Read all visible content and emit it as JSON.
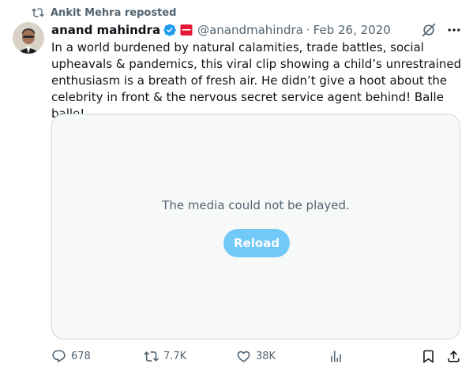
{
  "repost": {
    "text": "Ankit Mehra reposted",
    "icon": "repost-icon"
  },
  "author": {
    "name": "anand mahindra",
    "handle": "@anandmahindra",
    "separator": "·",
    "date": "Feb 26, 2020",
    "verified_icon": "verified-badge-icon",
    "affiliate_icon": "affiliate-badge-icon",
    "verified_color": "#1d9bf0",
    "affiliate_color": "#e31837"
  },
  "header_actions": {
    "grok_icon": "grok-icon",
    "more_icon": "more-icon"
  },
  "tweet": {
    "text": "In a world burdened by natural calamities, trade battles, social upheavals & pandemics, this viral clip showing a child’s unrestrained enthusiasm is a breath of fresh air. He didn’t give a hoot about the celebrity in front & the nervous secret service agent behind! Balle balle!"
  },
  "media": {
    "message": "The media could not be played.",
    "reload_label": "Reload",
    "reload_color": "#71c9f8"
  },
  "actions": {
    "reply_count": "678",
    "retweet_count": "7.7K",
    "like_count": "38K",
    "views_icon": "views-icon",
    "bookmark_icon": "bookmark-icon",
    "share_icon": "share-icon"
  },
  "colors": {
    "text": "#0f1419",
    "secondary": "#536471",
    "border": "#cfd9de",
    "accent": "#1d9bf0"
  }
}
